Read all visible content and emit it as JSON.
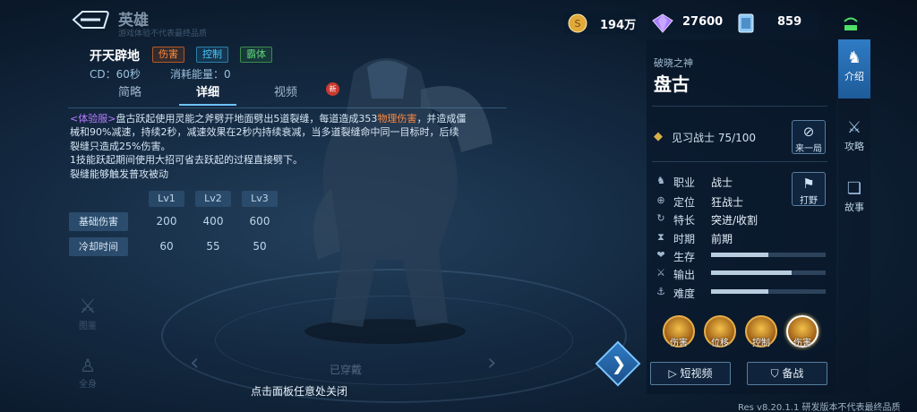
{
  "header": {
    "title": "英雄",
    "subtitle": "游戏体验不代表最终品质"
  },
  "currencies": [
    {
      "icon": "gold-coin-icon",
      "value": "194万"
    },
    {
      "icon": "diamond-icon",
      "value": "27600"
    },
    {
      "icon": "voucher-card-icon",
      "value": "859"
    }
  ],
  "skill": {
    "name": "开天辟地",
    "tags": [
      "伤害",
      "控制",
      "霸体"
    ],
    "cd": "CD：60秒",
    "energy": "消耗能量：0",
    "tabs": [
      "简略",
      "详细",
      "视频"
    ],
    "active_tab": 1,
    "new_badge": "新",
    "desc_tag": "<体验服>",
    "desc_1a": "盘古跃起使用灵能之斧劈开地面劈出5道裂缝，每道造成353",
    "desc_1b": "物理伤害",
    "desc_1c": "，并造成僵",
    "desc_2": "械和90%减速，持续2秒，减速效果在2秒内持续衰减，当多道裂缝命中同一目标时，后续",
    "desc_3": "裂缝只造成25%伤害。",
    "desc_4": "1技能跃起期间使用大招可省去跃起的过程直接劈下。",
    "desc_5": "裂缝能够触发普攻被动",
    "levels": [
      "Lv1",
      "Lv2",
      "Lv3"
    ],
    "rows": [
      {
        "label": "基础伤害",
        "values": [
          "200",
          "400",
          "600"
        ]
      },
      {
        "label": "冷却时间",
        "values": [
          "60",
          "55",
          "50"
        ]
      }
    ]
  },
  "left_side": {
    "item1": "图鉴",
    "item2": "全身"
  },
  "stage": {
    "worn": "已穿戴",
    "close_hint": "点击面板任意处关闭"
  },
  "hero": {
    "title": "破晓之神",
    "name": "盘古",
    "rank": "见习战士 75/100",
    "btn_last": "来一局",
    "btn_jungle": "打野",
    "attrs": [
      {
        "key": "职业",
        "value": "战士",
        "icon": "class-icon"
      },
      {
        "key": "定位",
        "value": "狂战士",
        "icon": "position-icon"
      },
      {
        "key": "特长",
        "value": "突进/收割",
        "icon": "specialty-icon"
      },
      {
        "key": "时期",
        "value": "前期",
        "icon": "period-icon"
      }
    ],
    "stats": [
      {
        "key": "生存",
        "value": 0.5
      },
      {
        "key": "输出",
        "value": 0.7
      },
      {
        "key": "难度",
        "value": 0.5
      }
    ],
    "badges": [
      "伤害",
      "位移",
      "控制",
      "伤害"
    ],
    "btn_video": "短视频",
    "btn_prepare": "备战"
  },
  "right_nav": [
    "介绍",
    "攻略",
    "故事"
  ],
  "res": "Res v8.20.1.1 研发版本不代表最终品质"
}
